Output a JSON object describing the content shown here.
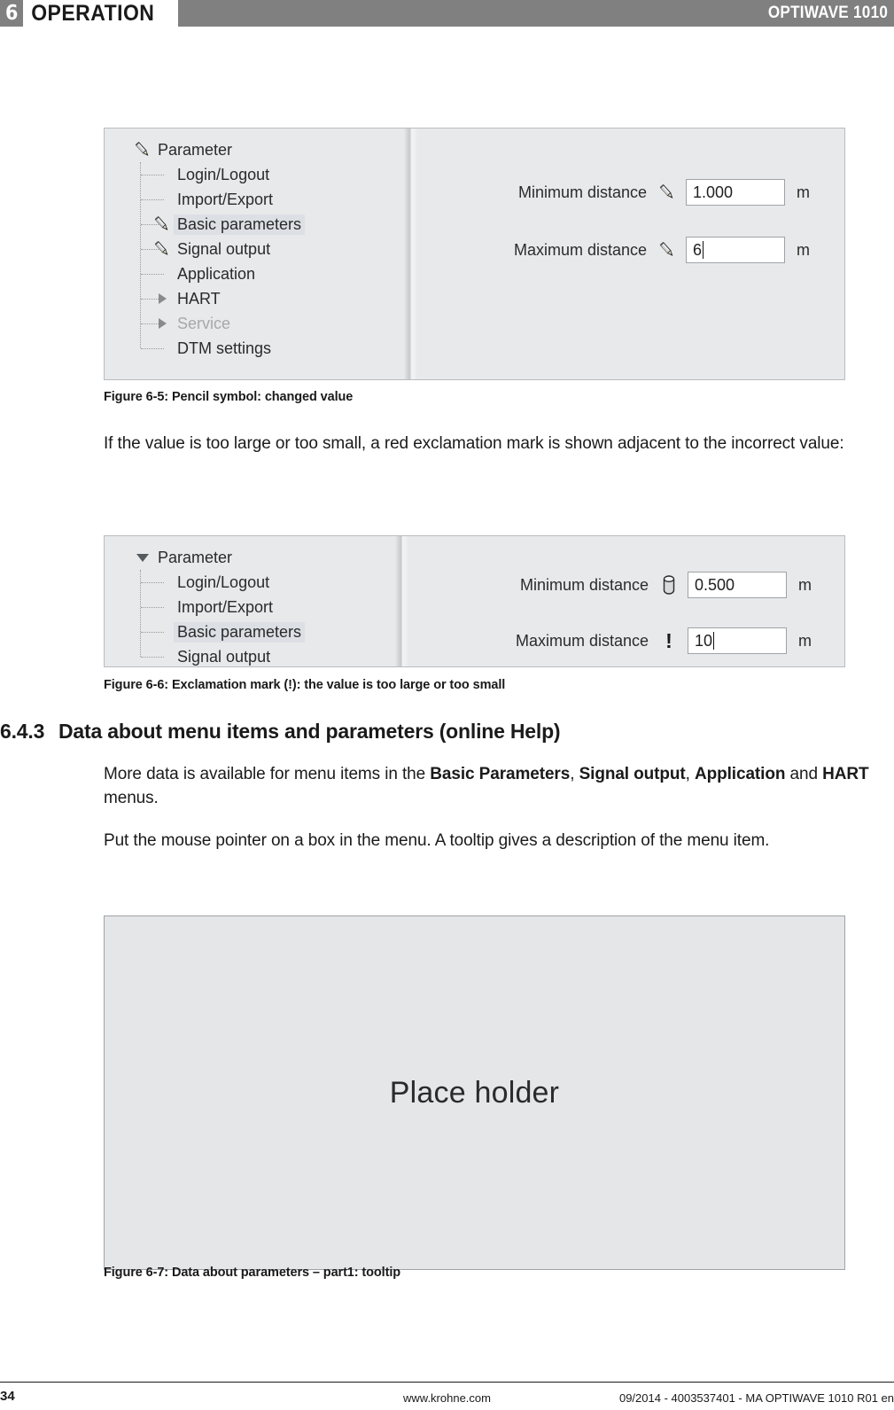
{
  "header": {
    "chapter_number": "6",
    "chapter_title": "OPERATION",
    "product": "OPTIWAVE 1010"
  },
  "figure_6_5": {
    "tree": {
      "root": {
        "label": "Parameter",
        "icon": "pencil-icon"
      },
      "items": [
        {
          "label": "Login/Logout",
          "icon": "none",
          "state": "normal"
        },
        {
          "label": "Import/Export",
          "icon": "none",
          "state": "normal"
        },
        {
          "label": "Basic parameters",
          "icon": "pencil-icon",
          "state": "selected"
        },
        {
          "label": "Signal output",
          "icon": "pencil-icon",
          "state": "normal"
        },
        {
          "label": "Application",
          "icon": "none",
          "state": "normal"
        },
        {
          "label": "HART",
          "icon": "triangle-right-icon",
          "state": "normal"
        },
        {
          "label": "Service",
          "icon": "triangle-right-icon",
          "state": "disabled"
        },
        {
          "label": "DTM settings",
          "icon": "none",
          "state": "normal"
        }
      ]
    },
    "parameters": [
      {
        "label": "Minimum distance",
        "icon": "pencil-icon",
        "value": "1.000",
        "unit": "m",
        "caret": false
      },
      {
        "label": "Maximum distance",
        "icon": "pencil-icon",
        "value": "6",
        "unit": "m",
        "caret": true
      }
    ],
    "caption": "Figure 6-5: Pencil symbol: changed value"
  },
  "paragraph_1": {
    "text": "If the value is too large or too small, a red exclamation mark is shown adjacent to the incorrect value:"
  },
  "figure_6_6": {
    "tree": {
      "root": {
        "label": "Parameter",
        "icon": "triangle-down-icon"
      },
      "items": [
        {
          "label": "Login/Logout",
          "icon": "none",
          "state": "normal"
        },
        {
          "label": "Import/Export",
          "icon": "none",
          "state": "normal"
        },
        {
          "label": "Basic parameters",
          "icon": "none",
          "state": "selected"
        },
        {
          "label": "Signal output",
          "icon": "none",
          "state": "normal"
        }
      ]
    },
    "parameters": [
      {
        "label": "Minimum distance",
        "icon": "cylinder-icon",
        "value": "0.500",
        "unit": "m",
        "caret": false
      },
      {
        "label": "Maximum distance",
        "icon": "exclamation-icon",
        "value": "10",
        "unit": "m",
        "caret": true
      }
    ],
    "caption": "Figure 6-6: Exclamation mark (!): the value is too large or too small"
  },
  "section": {
    "number": "6.4.3",
    "title": "Data about menu items and parameters (online Help)"
  },
  "paragraph_2": {
    "prefix": "More data is available for menu items in the ",
    "bold_1": "Basic Parameters",
    "sep_1": ", ",
    "bold_2": "Signal output",
    "sep_2": ", ",
    "bold_3": "Application",
    "sep_3": " and ",
    "bold_4": "HART",
    "suffix": " menus."
  },
  "paragraph_3": {
    "text": "Put the mouse pointer on a box in the menu. A tooltip gives a description of the menu item."
  },
  "figure_6_7": {
    "placeholder_text": "Place holder",
    "caption": "Figure 6-7: Data about parameters – part1: tooltip"
  },
  "footer": {
    "page_number": "34",
    "website": "www.krohne.com",
    "document_meta": "09/2014 - 4003537401 - MA OPTIWAVE 1010 R01 en"
  }
}
